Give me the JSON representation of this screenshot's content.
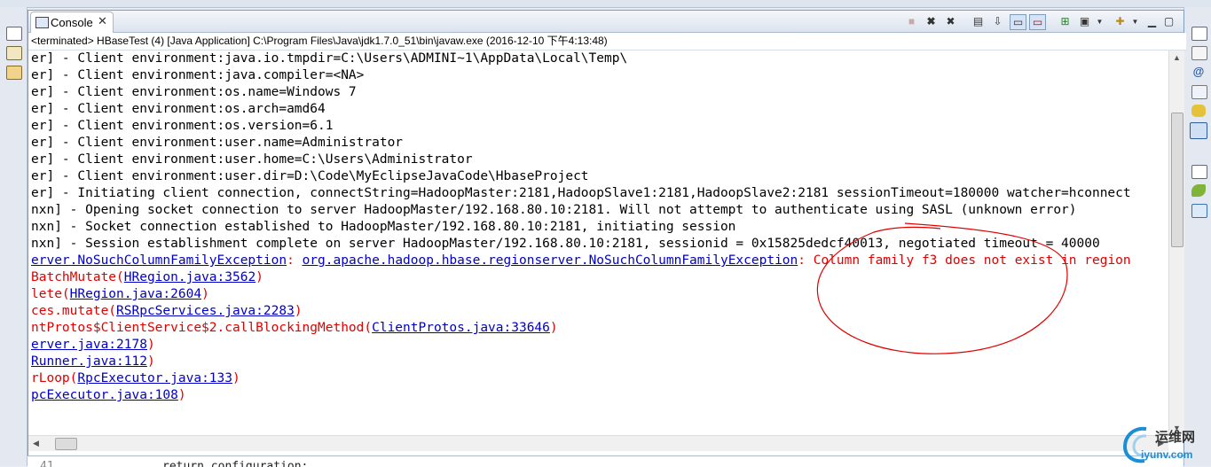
{
  "console": {
    "tab_label": "Console",
    "status": "<terminated> HBaseTest (4) [Java Application] C:\\Program Files\\Java\\jdk1.7.0_51\\bin\\javaw.exe (2016-12-10 下午4:13:48)",
    "lines": [
      {
        "type": "out",
        "text": "er] - Client environment:java.io.tmpdir=C:\\Users\\ADMINI~1\\AppData\\Local\\Temp\\"
      },
      {
        "type": "out",
        "text": "er] - Client environment:java.compiler=<NA>"
      },
      {
        "type": "out",
        "text": "er] - Client environment:os.name=Windows 7"
      },
      {
        "type": "out",
        "text": "er] - Client environment:os.arch=amd64"
      },
      {
        "type": "out",
        "text": "er] - Client environment:os.version=6.1"
      },
      {
        "type": "out",
        "text": "er] - Client environment:user.name=Administrator"
      },
      {
        "type": "out",
        "text": "er] - Client environment:user.home=C:\\Users\\Administrator"
      },
      {
        "type": "out",
        "text": "er] - Client environment:user.dir=D:\\Code\\MyEclipseJavaCode\\HbaseProject"
      },
      {
        "type": "out",
        "text": "er] - Initiating client connection, connectString=HadoopMaster:2181,HadoopSlave1:2181,HadoopSlave2:2181 sessionTimeout=180000 watcher=hconnect"
      },
      {
        "type": "out",
        "text": "nxn] - Opening socket connection to server HadoopMaster/192.168.80.10:2181. Will not attempt to authenticate using SASL (unknown error)"
      },
      {
        "type": "out",
        "text": "nxn] - Socket connection established to HadoopMaster/192.168.80.10:2181, initiating session"
      },
      {
        "type": "out",
        "text": "nxn] - Session establishment complete on server HadoopMaster/192.168.80.10:2181, sessionid = 0x15825dedcf40013, negotiated timeout = 40000"
      },
      {
        "type": "err",
        "pre": "",
        "link": "erver.NoSuchColumnFamilyException",
        "mid": ": ",
        "link2": "org.apache.hadoop.hbase.regionserver.NoSuchColumnFamilyException",
        "post": ": Column family f3 does not exist in region"
      },
      {
        "type": "err",
        "pre": "BatchMutate(",
        "link": "HRegion.java:3562",
        "post": ")"
      },
      {
        "type": "err",
        "pre": "lete(",
        "link": "HRegion.java:2604",
        "post": ")"
      },
      {
        "type": "err",
        "pre": "ces.mutate(",
        "link": "RSRpcServices.java:2283",
        "post": ")"
      },
      {
        "type": "err",
        "pre": "ntProtos$ClientService$2.callBlockingMethod(",
        "link": "ClientProtos.java:33646",
        "post": ")"
      },
      {
        "type": "err",
        "pre": "",
        "link": "erver.java:2178",
        "post": ")"
      },
      {
        "type": "err",
        "pre": "",
        "link": "Runner.java:112",
        "post": ")"
      },
      {
        "type": "err",
        "pre": "rLoop(",
        "link": "RpcExecutor.java:133",
        "post": ")"
      },
      {
        "type": "err",
        "pre": "",
        "link": "pcExecutor.java:108",
        "post": ")"
      }
    ]
  },
  "editor": {
    "line_number": "41",
    "code": "return configuration;"
  },
  "watermark": {
    "name": "运维网",
    "url": "iyunv.com"
  },
  "colors": {
    "stdout": "#000000",
    "stderr": "#e00000",
    "link": "#0000c8",
    "annotation": "#e00000"
  }
}
